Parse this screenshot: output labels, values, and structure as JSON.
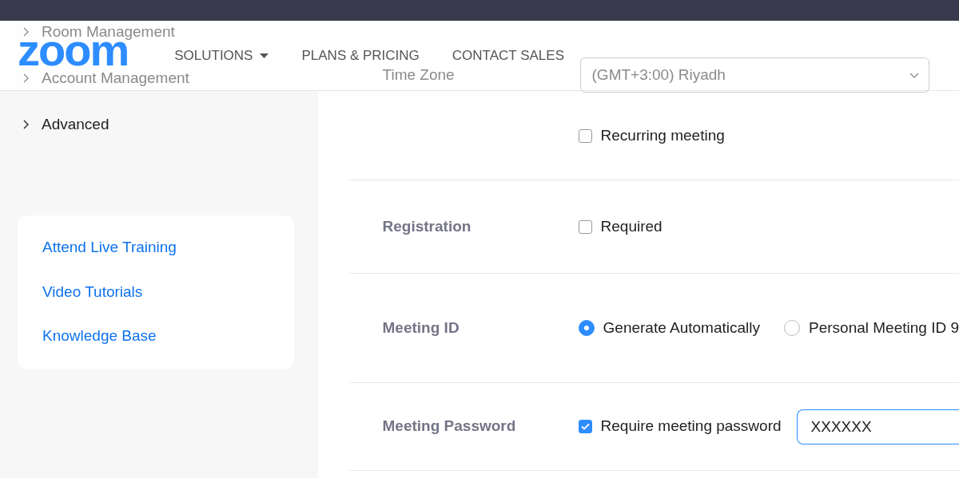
{
  "header": {
    "logo": "zoom",
    "nav": [
      {
        "label": "SOLUTIONS",
        "dropdown": true
      },
      {
        "label": "PLANS & PRICING",
        "dropdown": false
      },
      {
        "label": "CONTACT SALES",
        "dropdown": false
      }
    ]
  },
  "sidebar": {
    "items": [
      {
        "label": "Room Management",
        "expanded": false,
        "hidden_under_header": true
      },
      {
        "label": "Account Management",
        "expanded": false,
        "hidden_under_header": true
      },
      {
        "label": "Advanced",
        "expanded": false,
        "hidden_under_header": false
      }
    ],
    "help_links": [
      "Attend Live Training",
      "Video Tutorials",
      "Knowledge Base"
    ]
  },
  "form": {
    "time_zone": {
      "label": "Time Zone",
      "value": "(GMT+3:00) Riyadh"
    },
    "recurring": {
      "label": "Recurring meeting",
      "checked": false
    },
    "rows": [
      {
        "label": "Registration",
        "kind": "checkbox",
        "options": [
          {
            "label": "Required",
            "checked": false
          }
        ]
      },
      {
        "label": "Meeting ID",
        "kind": "radio",
        "options": [
          {
            "label": "Generate Automatically",
            "selected": true
          },
          {
            "label": "Personal Meeting ID 9",
            "selected": false
          }
        ]
      },
      {
        "label": "Meeting Password",
        "kind": "checkbox",
        "options": [
          {
            "label": "Require meeting password",
            "checked": true
          }
        ],
        "field_value": "XXXXXX"
      }
    ]
  }
}
